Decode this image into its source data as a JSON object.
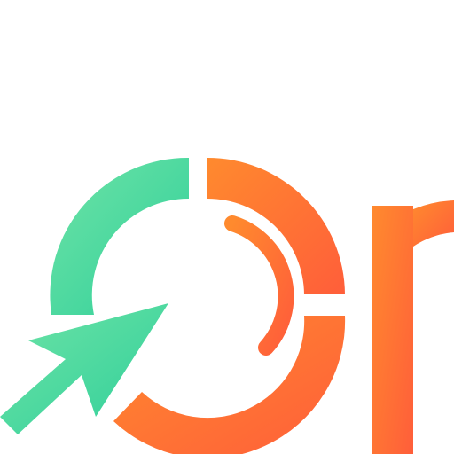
{
  "logo": {
    "name": "Op",
    "colors": {
      "green_light": "#6ee3a6",
      "green_dark": "#2fcf9a",
      "orange_light": "#ff8a2e",
      "orange_dark": "#ff5e3a"
    }
  }
}
